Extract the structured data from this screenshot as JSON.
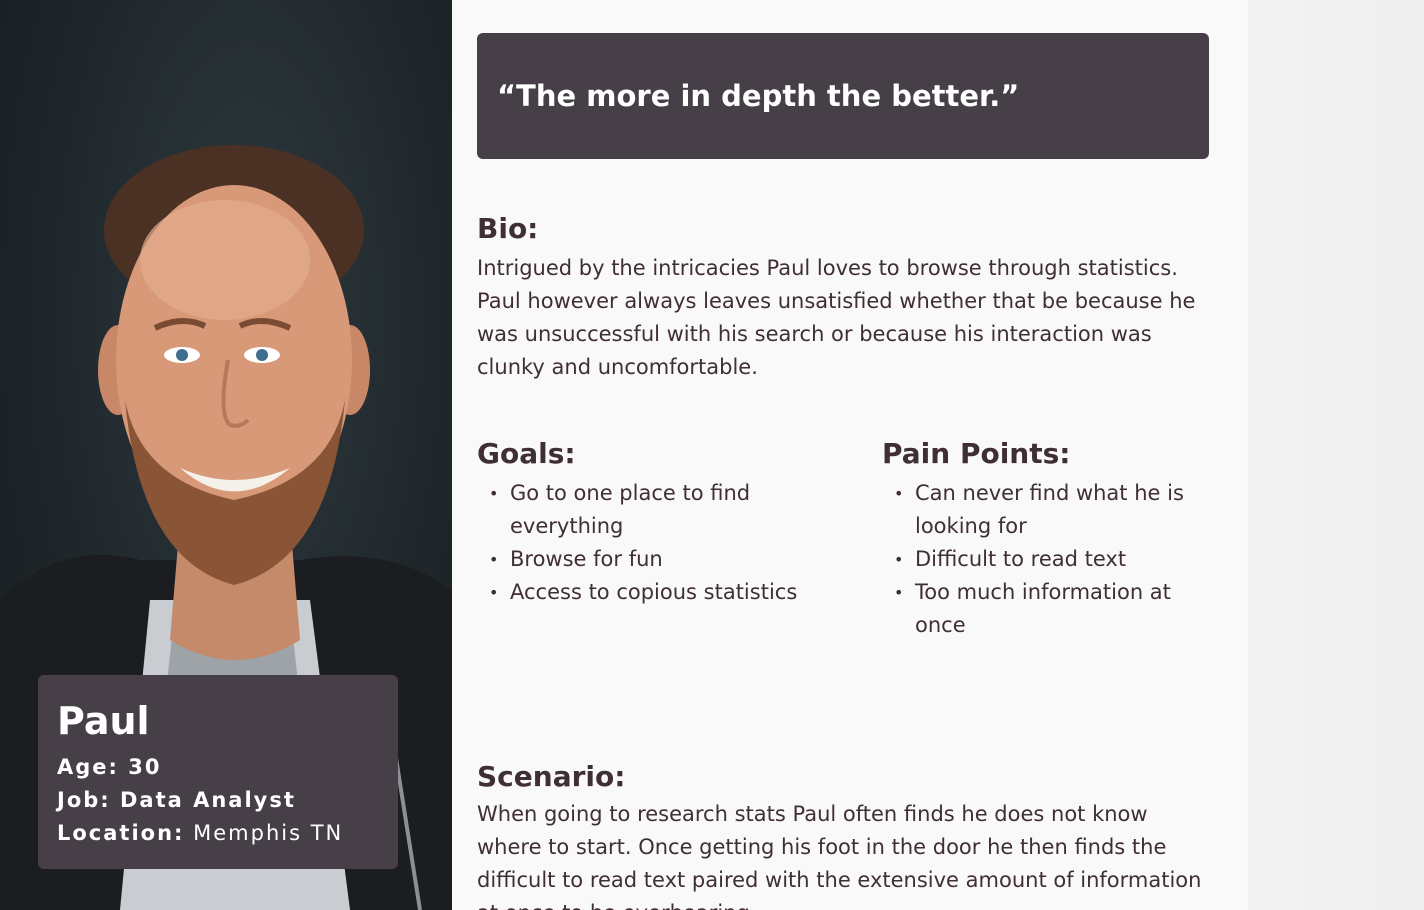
{
  "persona": {
    "name": "Paul",
    "facts": [
      {
        "key": "Age:",
        "value": " 30",
        "value_bold": true
      },
      {
        "key": "Job:",
        "value": " Data Analyst",
        "value_bold": true
      },
      {
        "key": "Location:",
        "value": " Memphis TN",
        "value_bold": false
      }
    ]
  },
  "quote": "“The more in depth the better.”",
  "bio": {
    "title": "Bio:",
    "text": "Intrigued by the intricacies Paul loves to browse through statistics. Paul however always leaves unsatisfied whether that be because he was unsuccessful with his search or because his interaction was clunky and uncomfortable."
  },
  "goals": {
    "title": "Goals:",
    "items": [
      "Go to one place to find everything",
      "Browse for fun",
      "Access to  copious statistics"
    ]
  },
  "pain_points": {
    "title": "Pain Points:",
    "items": [
      "Can never find what he is looking for",
      "Difficult to read text",
      "Too much information at once"
    ]
  },
  "scenario": {
    "title": "Scenario:",
    "text": "When going to research stats Paul often finds he does not know where to start. Once getting his foot in the door he then finds the difficult to read text paired with the extensive amount of information at once to be overbearing."
  },
  "colors": {
    "card_bg": "#463f47",
    "heading_text": "#3f2f33",
    "page_bg": "#f9f9f9",
    "photo_bg": "#1f272b"
  }
}
